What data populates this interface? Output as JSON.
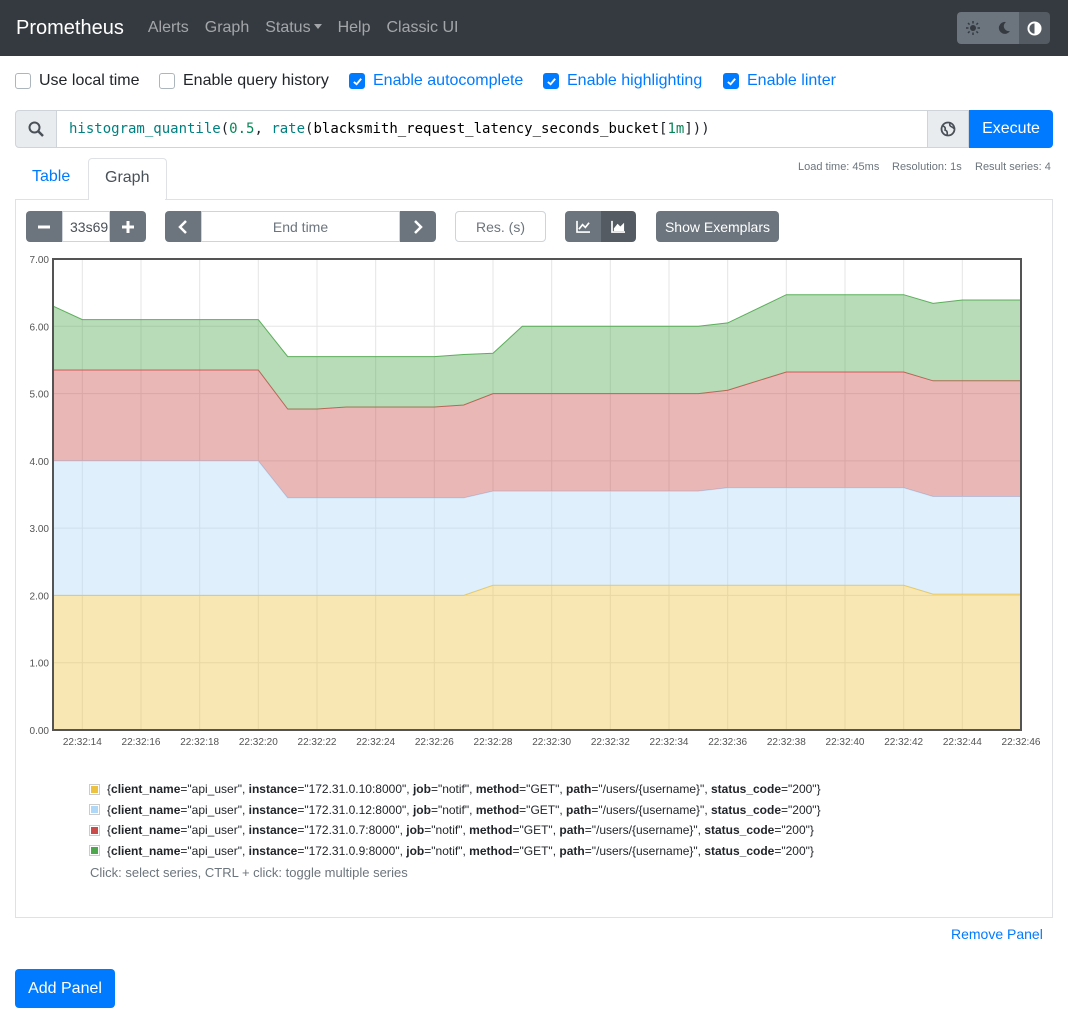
{
  "navbar": {
    "brand": "Prometheus",
    "links": [
      "Alerts",
      "Graph",
      "Status",
      "Help",
      "Classic UI"
    ],
    "theme_icons": [
      "sun-icon",
      "moon-icon",
      "adjust-icon"
    ]
  },
  "options": [
    {
      "label": "Use local time",
      "checked": false
    },
    {
      "label": "Enable query history",
      "checked": false
    },
    {
      "label": "Enable autocomplete",
      "checked": true
    },
    {
      "label": "Enable highlighting",
      "checked": true
    },
    {
      "label": "Enable linter",
      "checked": true
    }
  ],
  "query": {
    "fn1": "histogram_quantile",
    "arg1": "0.5",
    "fn2": "rate",
    "metric": "blacksmith_request_latency_seconds_bucket",
    "range": "1m",
    "execute_label": "Execute"
  },
  "tabs": {
    "table": "Table",
    "graph": "Graph"
  },
  "stats": {
    "load_time": "Load time: 45ms",
    "resolution": "Resolution: 1s",
    "result_series": "Result series: 4"
  },
  "controls": {
    "range_value": "33s69",
    "end_time_placeholder": "End time",
    "res_placeholder": "Res. (s)",
    "exemplars_label": "Show Exemplars"
  },
  "chart_data": {
    "type": "area",
    "stacked": true,
    "x": [
      "22:32:13",
      "22:32:14",
      "22:32:16",
      "22:32:18",
      "22:32:20",
      "22:32:21",
      "22:32:22",
      "22:32:23",
      "22:32:24",
      "22:32:26",
      "22:32:27",
      "22:32:28",
      "22:32:29",
      "22:32:30",
      "22:32:32",
      "22:32:34",
      "22:32:35",
      "22:32:36",
      "22:32:38",
      "22:32:40",
      "22:32:42",
      "22:32:43",
      "22:32:44",
      "22:32:46"
    ],
    "x_ticks": [
      "22:32:14",
      "22:32:16",
      "22:32:18",
      "22:32:20",
      "22:32:22",
      "22:32:24",
      "22:32:26",
      "22:32:28",
      "22:32:30",
      "22:32:32",
      "22:32:34",
      "22:32:36",
      "22:32:38",
      "22:32:40",
      "22:32:42",
      "22:32:44",
      "22:32:46"
    ],
    "y_ticks": [
      "0.00",
      "1.00",
      "2.00",
      "3.00",
      "4.00",
      "5.00",
      "6.00",
      "7.00"
    ],
    "ylim": [
      0,
      7
    ],
    "series": [
      {
        "name": "{client_name=\"api_user\", instance=\"172.31.0.10:8000\", job=\"notif\", method=\"GET\", path=\"/users/{username}\", status_code=\"200\"}",
        "color": "#edc240",
        "values": [
          2.0,
          2.0,
          2.0,
          2.0,
          2.0,
          2.0,
          2.0,
          2.0,
          2.0,
          2.0,
          2.0,
          2.15,
          2.15,
          2.15,
          2.15,
          2.15,
          2.15,
          2.15,
          2.15,
          2.15,
          2.15,
          2.02,
          2.02,
          2.02
        ]
      },
      {
        "name": "{client_name=\"api_user\", instance=\"172.31.0.12:8000\", job=\"notif\", method=\"GET\", path=\"/users/{username}\", status_code=\"200\"}",
        "color": "#afd8f8",
        "values": [
          2.0,
          2.0,
          2.0,
          2.0,
          2.0,
          1.45,
          1.45,
          1.45,
          1.45,
          1.45,
          1.45,
          1.4,
          1.4,
          1.4,
          1.4,
          1.4,
          1.4,
          1.45,
          1.45,
          1.45,
          1.45,
          1.45,
          1.45,
          1.45
        ]
      },
      {
        "name": "{client_name=\"api_user\", instance=\"172.31.0.7:8000\", job=\"notif\", method=\"GET\", path=\"/users/{username}\", status_code=\"200\"}",
        "color": "#cb4b4b",
        "values": [
          1.35,
          1.35,
          1.35,
          1.35,
          1.35,
          1.32,
          1.32,
          1.35,
          1.35,
          1.35,
          1.38,
          1.45,
          1.45,
          1.45,
          1.45,
          1.45,
          1.45,
          1.45,
          1.72,
          1.72,
          1.72,
          1.72,
          1.72,
          1.72
        ]
      },
      {
        "name": "{client_name=\"api_user\", instance=\"172.31.0.9:8000\", job=\"notif\", method=\"GET\", path=\"/users/{username}\", status_code=\"200\"}",
        "color": "#4da74d",
        "values": [
          0.95,
          0.75,
          0.75,
          0.75,
          0.75,
          0.78,
          0.78,
          0.75,
          0.75,
          0.75,
          0.75,
          0.6,
          1.0,
          1.0,
          1.0,
          1.0,
          1.0,
          1.0,
          1.15,
          1.15,
          1.15,
          1.15,
          1.2,
          1.2
        ]
      }
    ]
  },
  "legend": {
    "items": [
      {
        "color": "#edc240",
        "instance": "172.31.0.10:8000"
      },
      {
        "color": "#afd8f8",
        "instance": "172.31.0.12:8000"
      },
      {
        "color": "#cb4b4b",
        "instance": "172.31.0.7:8000"
      },
      {
        "color": "#4da74d",
        "instance": "172.31.0.9:8000"
      }
    ],
    "client_name": "api_user",
    "job": "notif",
    "method": "GET",
    "path": "/users/{username}",
    "status_code": "200",
    "hint": "Click: select series, CTRL + click: toggle multiple series"
  },
  "remove_panel_label": "Remove Panel",
  "add_panel_label": "Add Panel"
}
